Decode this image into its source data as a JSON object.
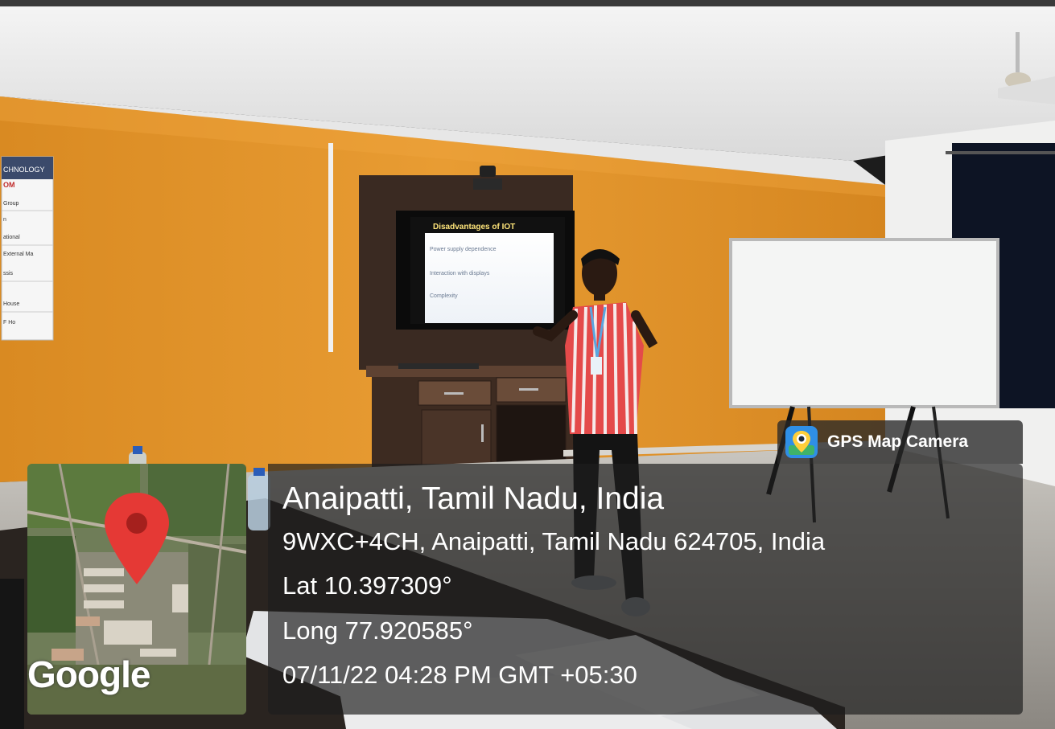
{
  "scene": {
    "slide": {
      "title": "Disadvantages of IOT",
      "bullets": [
        "Power supply dependence",
        "Interaction with displays",
        "Complexity"
      ]
    },
    "notice_board": {
      "heading": "CHNOLOGY",
      "subheading": "OM",
      "rows": [
        "Group",
        "n",
        "ational",
        "External Ma",
        "ssis",
        "",
        "House",
        "F Ho"
      ]
    }
  },
  "badge": {
    "label": "GPS Map Camera",
    "icon": "gps-map-camera-app-icon"
  },
  "map": {
    "attribution": "Google",
    "marker_icon": "map-pin-icon",
    "marker_color": "#e53935"
  },
  "location": {
    "title": "Anaipatti, Tamil Nadu, India",
    "address": "9WXC+4CH, Anaipatti, Tamil Nadu 624705, India",
    "latitude": "Lat 10.397309°",
    "longitude": "Long 77.920585°",
    "datetime": "07/11/22 04:28 PM GMT +05:30"
  },
  "colors": {
    "wall": "#e09428",
    "ceiling": "#eeeeee",
    "overlay": "#1e1e1e"
  }
}
